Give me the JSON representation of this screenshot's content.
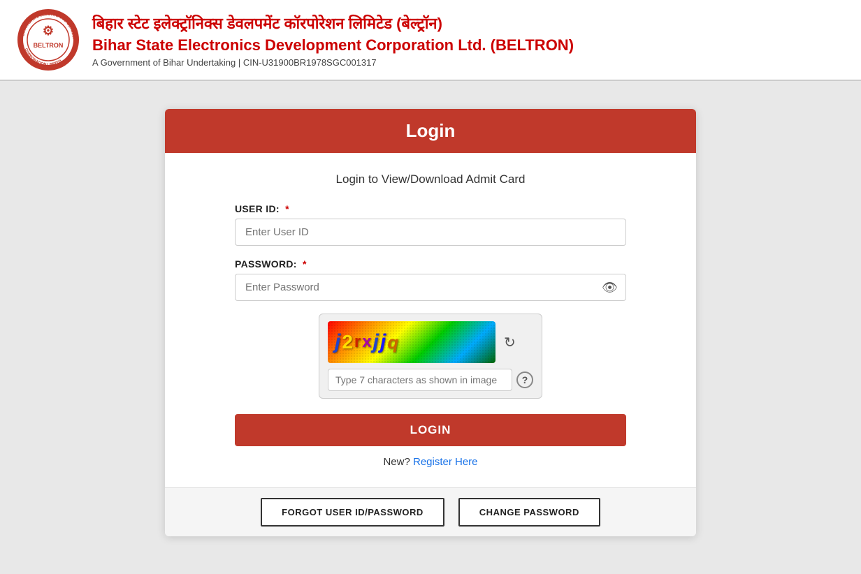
{
  "header": {
    "hindi_title": "बिहार स्टेट इलेक्ट्रॉनिक्स डेवलपमेंट कॉरपोरेशन लिमिटेड",
    "hindi_brand": "(बेल्ट्रॉन)",
    "english_title": "Bihar State Electronics Development Corporation Ltd.",
    "english_brand": "(BELTRON)",
    "subtitle": "A Government of Bihar Undertaking | CIN-U31900BR1978SGC001317"
  },
  "card": {
    "header_title": "Login",
    "subtitle": "Login to View/Download Admit Card",
    "user_id_label": "USER ID:",
    "user_id_placeholder": "Enter User ID",
    "password_label": "PASSWORD:",
    "password_placeholder": "Enter Password",
    "captcha_placeholder": "Type 7 characters as shown in image",
    "login_button": "LOGIN",
    "register_text": "New?",
    "register_link": "Register Here",
    "forgot_button": "FORGOT USER ID/PASSWORD",
    "change_password_button": "CHANGE PASSWORD"
  },
  "captcha": {
    "chars": [
      {
        "text": "j",
        "color": "#2244cc",
        "style": "italic bold"
      },
      {
        "text": "2",
        "color": "#ffdd00",
        "style": "bold"
      },
      {
        "text": "r",
        "color": "#cc2200",
        "style": "normal"
      },
      {
        "text": "x",
        "color": "#aa00aa",
        "style": "bold"
      },
      {
        "text": "j",
        "color": "#2244cc",
        "style": "italic bold"
      },
      {
        "text": "j",
        "color": "#2244cc",
        "style": "italic bold"
      },
      {
        "text": "q",
        "color": "#cc6600",
        "style": "italic"
      }
    ]
  },
  "icons": {
    "eye": "👁",
    "refresh": "↻",
    "help": "?"
  }
}
